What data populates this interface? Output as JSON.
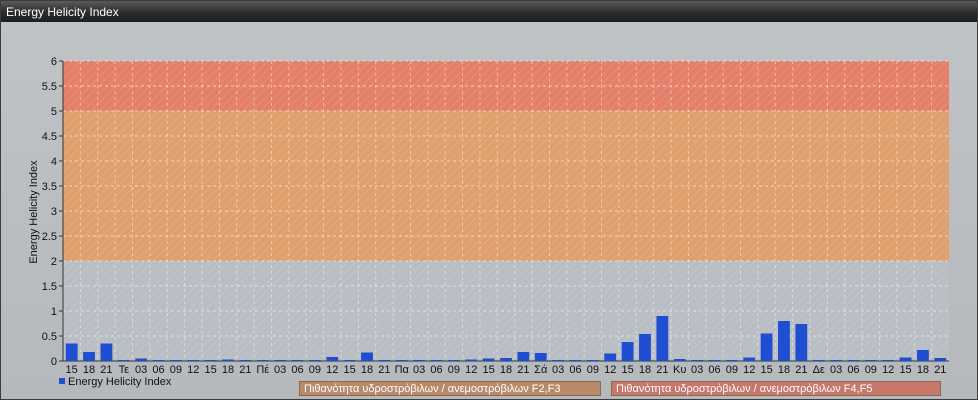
{
  "window": {
    "title": "Energy Helicity Index"
  },
  "legend": {
    "series_label": "Energy Helicity Index",
    "band_f2f3": "Πιθανότητα υδροστρόβιλων / ανεμοστρόβιλων F2,F3",
    "band_f4f5": "Πιθανότητα υδροστρόβιλων / ανεμοστρόβιλων F4,F5"
  },
  "colors": {
    "bar": "#1f4fd0",
    "band_low": "#b8bec3",
    "band_f2f3": "#dfa06e",
    "band_f4f5": "#e4806a"
  },
  "chart_data": {
    "type": "bar",
    "ylabel": "Energy Helicity Index",
    "ylim": [
      0,
      6
    ],
    "yticks": [
      "0",
      "0.5",
      "1",
      "1.5",
      "2",
      "2.5",
      "3",
      "3.5",
      "4",
      "4.5",
      "5",
      "5.5",
      "6"
    ],
    "grid": true,
    "bands": [
      {
        "from": 0,
        "to": 2,
        "color": "#b8bec3"
      },
      {
        "from": 2,
        "to": 5,
        "color": "#dfa06e"
      },
      {
        "from": 5,
        "to": 6,
        "color": "#e4806a"
      }
    ],
    "categories": [
      "15",
      "18",
      "21",
      "Τε",
      "03",
      "06",
      "09",
      "12",
      "15",
      "18",
      "21",
      "Πέ",
      "03",
      "06",
      "09",
      "12",
      "15",
      "18",
      "21",
      "Πα",
      "03",
      "06",
      "09",
      "12",
      "15",
      "18",
      "21",
      "Σά",
      "03",
      "06",
      "09",
      "12",
      "15",
      "18",
      "21",
      "Κυ",
      "03",
      "06",
      "09",
      "12",
      "15",
      "18",
      "21",
      "Δε",
      "03",
      "06",
      "09",
      "12",
      "15",
      "18",
      "21"
    ],
    "series": [
      {
        "name": "Energy Helicity Index",
        "values": [
          0.35,
          0.18,
          0.35,
          0.02,
          0.05,
          0.02,
          0.02,
          0.02,
          0.02,
          0.03,
          0.02,
          0.02,
          0.02,
          0.02,
          0.02,
          0.08,
          0.02,
          0.17,
          0.02,
          0.02,
          0.02,
          0.02,
          0.02,
          0.03,
          0.05,
          0.06,
          0.18,
          0.16,
          0.02,
          0.02,
          0.02,
          0.15,
          0.38,
          0.54,
          0.9,
          0.04,
          0.02,
          0.02,
          0.02,
          0.07,
          0.55,
          0.8,
          0.74,
          0.02,
          0.02,
          0.02,
          0.02,
          0.02,
          0.07,
          0.22,
          0.06
        ]
      }
    ]
  }
}
